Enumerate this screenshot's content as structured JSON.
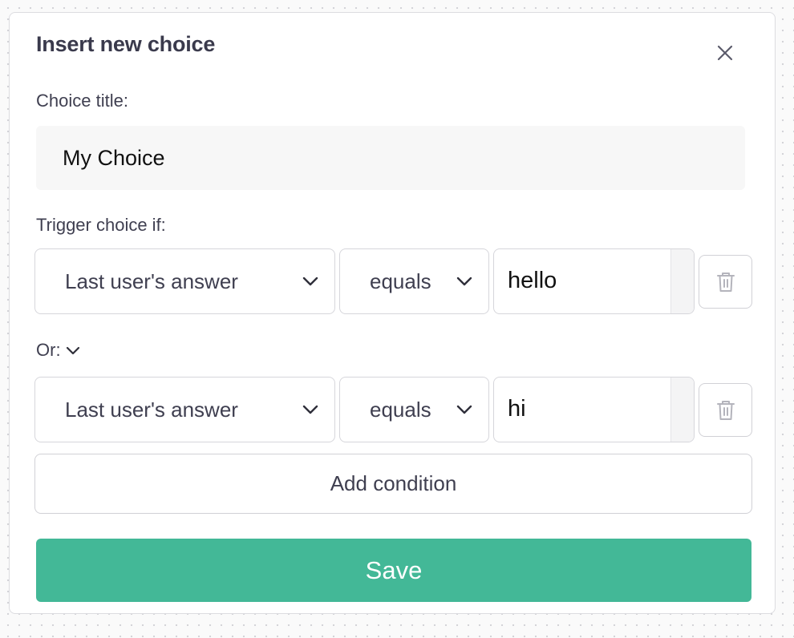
{
  "modal": {
    "title": "Insert new choice",
    "close_icon": "close-icon"
  },
  "choice_title": {
    "label": "Choice title:",
    "value": "My Choice"
  },
  "trigger": {
    "label": "Trigger choice if:",
    "or_label": "Or:",
    "conditions": [
      {
        "field": "Last user's answer",
        "operator": "equals",
        "value": "hello",
        "delete_icon": "trash-icon"
      },
      {
        "field": "Last user's answer",
        "operator": "equals",
        "value": "hi",
        "delete_icon": "trash-icon"
      }
    ]
  },
  "actions": {
    "add_condition_label": "Add condition",
    "save_label": "Save"
  },
  "colors": {
    "accent": "#43b897",
    "text": "#3f3f50",
    "border": "#d6d6db",
    "input_bg": "#f7f7f7"
  }
}
